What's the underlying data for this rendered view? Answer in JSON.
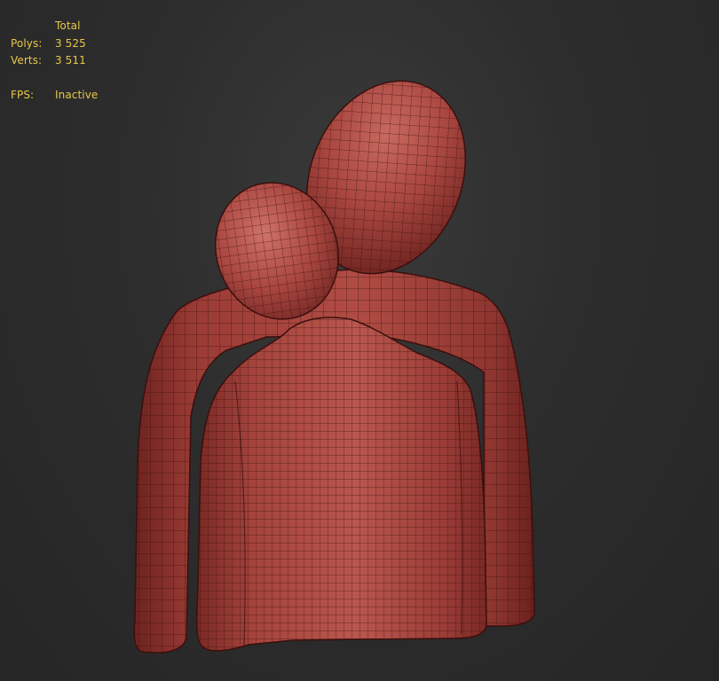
{
  "viewport": {
    "name": "3d-viewport",
    "background_color": "#2b2b2b",
    "mesh_color": "#a8433c"
  },
  "stats": {
    "column_header": "Total",
    "polys_label": "Polys:",
    "polys_value": "3 525",
    "verts_label": "Verts:",
    "verts_value": "3 511",
    "fps_label": "FPS:",
    "fps_value": "Inactive"
  }
}
